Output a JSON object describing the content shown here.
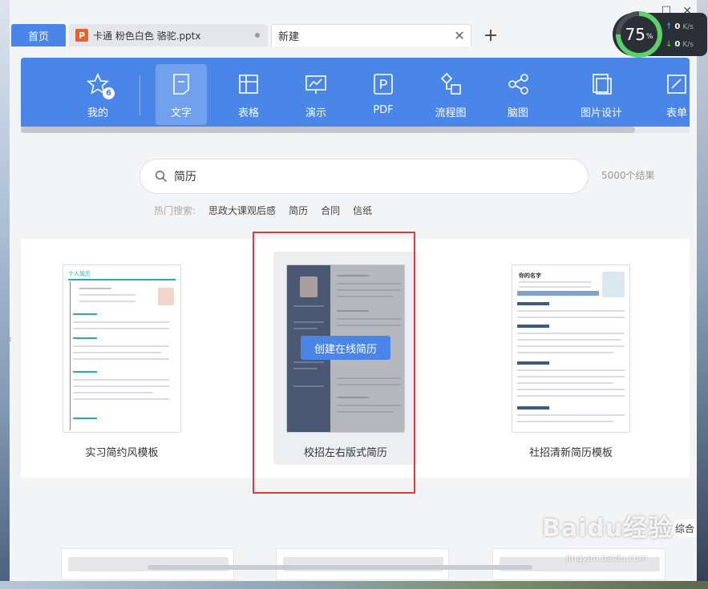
{
  "tabs": {
    "home": "首页",
    "doc": "卡通 粉色白色 骆驼.pptx",
    "doc_icon": "P",
    "new": "新建",
    "close_glyph": "✕",
    "add_glyph": "+"
  },
  "perf": {
    "percent": "75",
    "percent_unit": "%",
    "up": "0",
    "down": "0",
    "unit": "K/s"
  },
  "categories": [
    {
      "label": "我的",
      "badge": "6",
      "icon": "star-icon"
    },
    {
      "label": "文字",
      "icon": "doc-icon"
    },
    {
      "label": "表格",
      "icon": "table-icon"
    },
    {
      "label": "演示",
      "icon": "presentation-icon"
    },
    {
      "label": "PDF",
      "icon": "pdf-icon"
    },
    {
      "label": "流程图",
      "icon": "flowchart-icon"
    },
    {
      "label": "脑图",
      "icon": "mindmap-icon"
    },
    {
      "label": "图片设计",
      "icon": "image-design-icon"
    },
    {
      "label": "表单",
      "icon": "form-icon"
    }
  ],
  "search": {
    "value": "简历",
    "result_count": "5000个结果"
  },
  "hot": {
    "label": "热门搜索:",
    "items": [
      "思政大课观后感",
      "简历",
      "合同",
      "信纸"
    ]
  },
  "templates": [
    {
      "label": "实习简约风模板",
      "thumb_title": "个人简历"
    },
    {
      "label": "校招左右版式简历",
      "action": "创建在线简历"
    },
    {
      "label": "社招清新简历模板",
      "thumb_title": "你的名字"
    }
  ],
  "side_tag": "综合",
  "watermark": {
    "brand": "Baidu经验",
    "url": "jingyan.baidu.com"
  },
  "colors": {
    "accent": "#4a86e8",
    "highlight": "#e03a3a"
  }
}
